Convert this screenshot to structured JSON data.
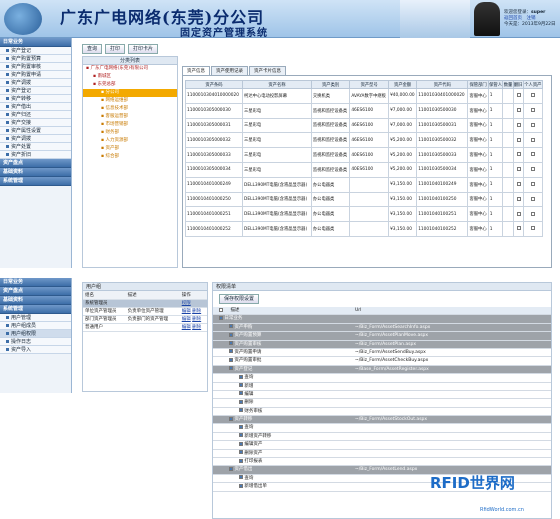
{
  "header": {
    "title": "广东广电网络(东莞)分公司",
    "subtitle": "固定资产管理系统",
    "welcome": "欢迎您登录：",
    "user": "super",
    "links": "返回首页　注销",
    "date": "今天是：2013年9月22日"
  },
  "nav1": {
    "section1": "日常业务",
    "items": [
      "资产登记",
      "资产购置预算",
      "资产购置审核",
      "资产购置申请",
      "资产调拨",
      "资产登记",
      "资产转移",
      "资产借出",
      "资产归还",
      "资产交接",
      "资产属性设置",
      "资产调拨",
      "资产处置",
      "资产折旧"
    ],
    "section2": "资产盘点",
    "section3": "基础资料",
    "section4": "系统管理"
  },
  "toolbar": {
    "query": "查询",
    "print": "打印",
    "print_card": "打印卡片"
  },
  "tree": {
    "head": "分类列表",
    "root": "广东广电网络(东莞)有限公司",
    "nodes": [
      "南城区",
      "东莞总部",
      "分公司",
      "网络运维部",
      "信息技术部",
      "客服运营部",
      "市场营销部",
      "财务部",
      "人力资源部",
      "资产部",
      "综合部"
    ]
  },
  "tabs": [
    "资产信息",
    "资产使用记录",
    "资产卡片信息"
  ],
  "grid": {
    "headers": [
      "资产条码",
      "资产名称",
      "资产类别",
      "资产型号",
      "资产金额",
      "资产代码",
      "保管部门",
      "保管人",
      "数量",
      "翻旧",
      "个人资产"
    ],
    "rows": [
      [
        "1100010304010000020",
        "柯达中心电动投影屏幕",
        "交换机类",
        "AVAYA数字中继板",
        "¥40,000.00",
        "11001030401000020",
        "客服中心",
        "1",
        "",
        "",
        ""
      ],
      [
        "1100010305000030",
        "三星彩电",
        "监视和监控设备类",
        "46ES6100",
        "¥7,000.00",
        "11001030500030",
        "客服中心",
        "1",
        "",
        "",
        ""
      ],
      [
        "1100010305000031",
        "三星彩电",
        "监视和监控设备类",
        "46ES6100",
        "¥7,000.00",
        "11001030500031",
        "客服中心",
        "1",
        "",
        "",
        ""
      ],
      [
        "1100010305000032",
        "三星彩电",
        "监视和监控设备类",
        "46ES6100",
        "¥5,200.00",
        "11001030500032",
        "客服中心",
        "1",
        "",
        "",
        ""
      ],
      [
        "1100010305000033",
        "三星彩电",
        "监视和监控设备类",
        "40ES6100",
        "¥5,200.00",
        "11001030500033",
        "客服中心",
        "1",
        "",
        "",
        ""
      ],
      [
        "1100010305000034",
        "三星彩电",
        "监视和监控设备类",
        "40ES6100",
        "¥5,200.00",
        "11001030500034",
        "客服中心",
        "1",
        "",
        "",
        ""
      ],
      [
        "1100010401000249",
        "DELL390MT电脑(含液晶显示器)",
        "办公电器类",
        "",
        "¥3,150.00",
        "11001040100249",
        "客服中心",
        "1",
        "",
        "",
        ""
      ],
      [
        "1100010401000250",
        "DELL390MT电脑(含液晶显示器)",
        "办公电器类",
        "",
        "¥3,150.00",
        "11001040100250",
        "客服中心",
        "1",
        "",
        "",
        ""
      ],
      [
        "1100010401000251",
        "DELL390MT电脑(含液晶显示器)",
        "办公电器类",
        "",
        "¥3,150.00",
        "11001040100251",
        "客服中心",
        "1",
        "",
        "",
        ""
      ],
      [
        "1100010401000252",
        "DELL390MT电脑(含液晶显示器)",
        "办公电器类",
        "",
        "¥3,150.00",
        "11001040100252",
        "客服中心",
        "1",
        "",
        "",
        ""
      ]
    ]
  },
  "nav2": {
    "items": [
      "日常业务",
      "资产盘点",
      "基础资料",
      "系统管理",
      "用户管理",
      "用户组成员",
      "用户组权限",
      "操作日志",
      "资产导入"
    ]
  },
  "users": {
    "head": "用户组",
    "col_name": "组名",
    "col_desc": "描述",
    "col_op": "操作",
    "rows": [
      {
        "name": "系统管理员",
        "desc": "",
        "op1": "权限",
        "op2": ""
      },
      {
        "name": "单位资产管理员",
        "desc": "负责单位资产管理",
        "op1": "编辑",
        "op2": "删除"
      },
      {
        "name": "部门资产管理员",
        "desc": "负责部门的资产管理",
        "op1": "编辑",
        "op2": "删除"
      },
      {
        "name": "普通用户",
        "desc": "",
        "op1": "编辑",
        "op2": "删除"
      }
    ]
  },
  "perm": {
    "head": "权限清单",
    "save": "保存权限设置",
    "col_desc": "描述",
    "col_url": "Url",
    "rows": [
      {
        "t": "日常业务",
        "u": "",
        "g": 1,
        "lv": 0
      },
      {
        "t": "资产申购",
        "u": "~/Biz_Form/AssetSearchInfo.aspx",
        "g": 1,
        "lv": 1
      },
      {
        "t": "资产购置预算",
        "u": "~/Biz_Form/AssetPlanMove.aspx",
        "g": 1,
        "lv": 1
      },
      {
        "t": "资产购置审核",
        "u": "~/Biz_Form/AssetPlan.aspx",
        "g": 1,
        "lv": 1
      },
      {
        "t": "资产购置申请",
        "u": "~/Biz_Form/AssetSendBuy.aspx",
        "g": 0,
        "lv": 1
      },
      {
        "t": "资产购置审批",
        "u": "~/Biz_Form/AssetCheckBuy.aspx",
        "g": 0,
        "lv": 1
      },
      {
        "t": "资产登记",
        "u": "~/Base_Form/AssetRegister.aspx",
        "g": 1,
        "lv": 1
      },
      {
        "t": "查询",
        "u": "",
        "g": 0,
        "lv": 2
      },
      {
        "t": "新增",
        "u": "",
        "g": 0,
        "lv": 2
      },
      {
        "t": "编辑",
        "u": "",
        "g": 0,
        "lv": 2
      },
      {
        "t": "删除",
        "u": "",
        "g": 0,
        "lv": 2
      },
      {
        "t": "财务审核",
        "u": "",
        "g": 0,
        "lv": 2
      },
      {
        "t": "资产转移",
        "u": "~/Biz_Form/AssetStockOut.aspx",
        "g": 1,
        "lv": 1
      },
      {
        "t": "查询",
        "u": "",
        "g": 0,
        "lv": 2
      },
      {
        "t": "新增资产转移",
        "u": "",
        "g": 0,
        "lv": 2
      },
      {
        "t": "编辑资产",
        "u": "",
        "g": 0,
        "lv": 2
      },
      {
        "t": "删除资产",
        "u": "",
        "g": 0,
        "lv": 2
      },
      {
        "t": "打印报表",
        "u": "",
        "g": 0,
        "lv": 2
      },
      {
        "t": "资产借出",
        "u": "~/Biz_Form/AssetLend.aspx",
        "g": 1,
        "lv": 1
      },
      {
        "t": "查询",
        "u": "",
        "g": 0,
        "lv": 2
      },
      {
        "t": "新增借出单",
        "u": "",
        "g": 0,
        "lv": 2
      }
    ]
  },
  "watermark": {
    "brand": "RFID世界网",
    "url": "RfidWorld.com.cn"
  }
}
